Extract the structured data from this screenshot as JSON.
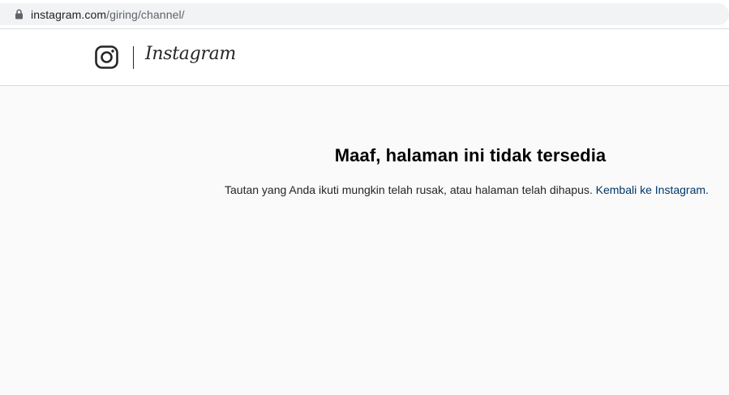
{
  "browser": {
    "url_host": "instagram.com",
    "url_path": "/giring/channel/",
    "lock_icon": "lock-icon"
  },
  "header": {
    "logo_icon": "instagram-glyph-icon",
    "wordmark": "Instagram"
  },
  "error": {
    "title": "Maaf, halaman ini tidak tersedia",
    "description": "Tautan yang Anda ikuti mungkin telah rusak, atau halaman telah dihapus. ",
    "link_label": "Kembali ke Instagram",
    "trailing": "."
  },
  "colors": {
    "link": "#00376b",
    "page_background": "#fafafa",
    "text": "#262626"
  }
}
